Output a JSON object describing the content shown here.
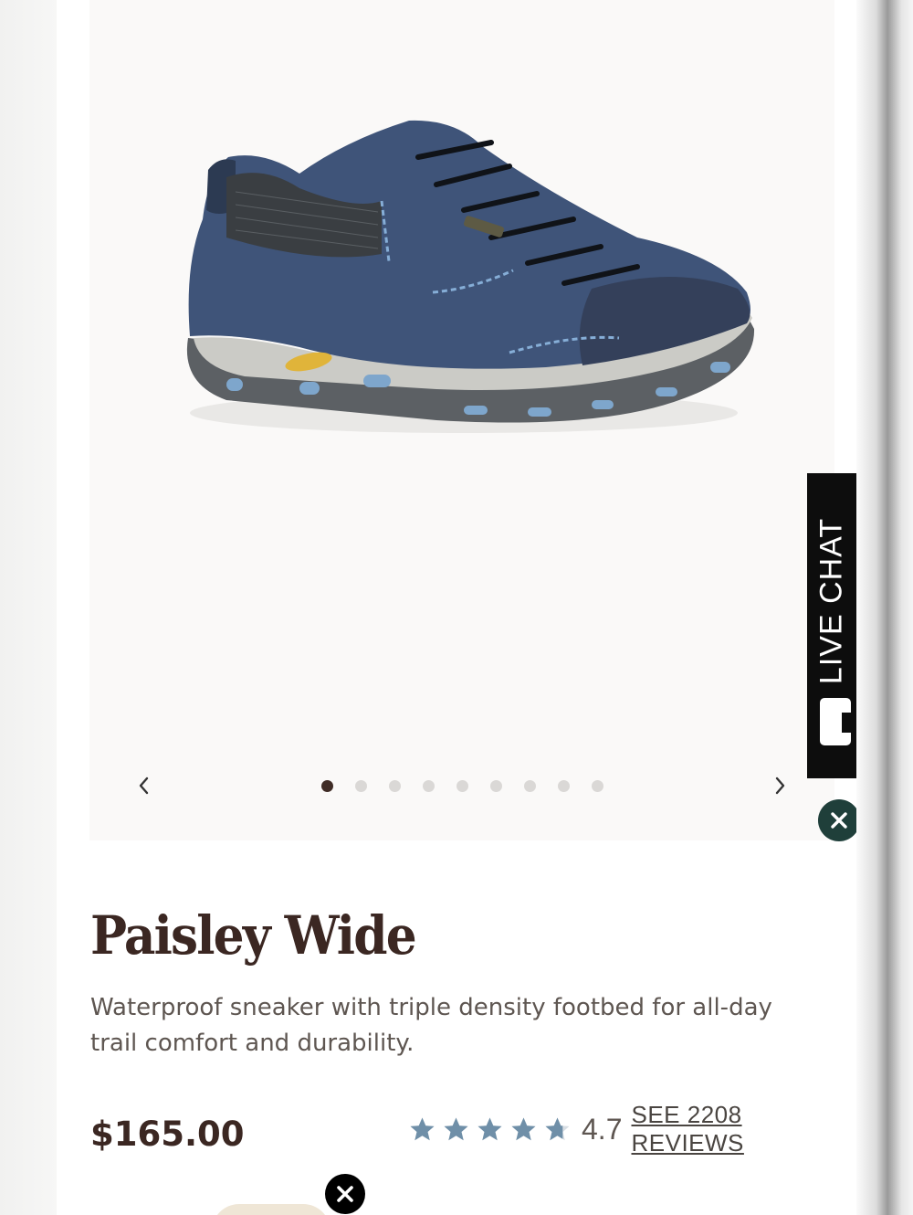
{
  "gallery": {
    "product_image_alt": "Blue suede waterproof hiking sneaker with Vibram sole",
    "dot_count": 9,
    "active_index": 0,
    "prev_icon": "chevron-left-icon",
    "next_icon": "chevron-right-icon"
  },
  "live_chat": {
    "label": "LIVE CHAT",
    "icon": "chat-bubble-icon"
  },
  "product": {
    "title": "Paisley Wide",
    "description": "Waterproof sneaker with triple density footbed for all-day trail comfort and durability.",
    "price": "$165.00",
    "rating_value": "4.7",
    "rating_fraction": 0.94,
    "reviews_link": "SEE 2208 REVIEWS"
  },
  "colors": {
    "title": "#3b2722",
    "star": "#6f8fa8",
    "dismiss_bg": "#1f3f3a"
  }
}
